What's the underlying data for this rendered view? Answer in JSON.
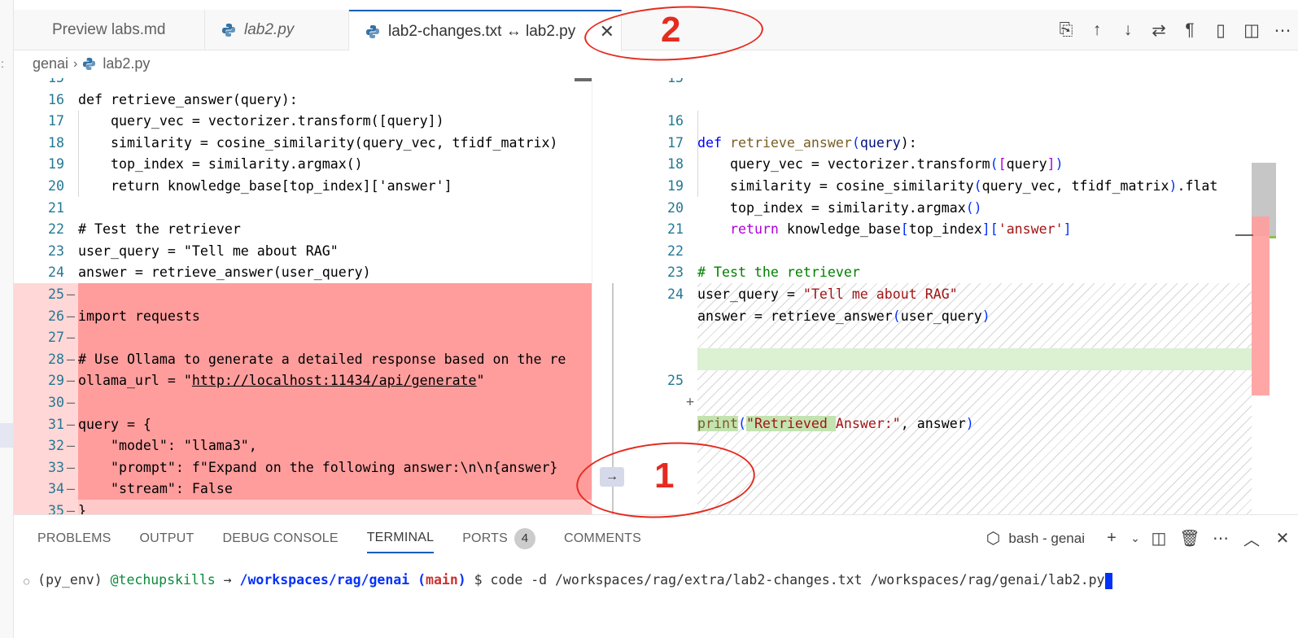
{
  "tabs": [
    {
      "label": "Preview labs.md",
      "active": false
    },
    {
      "label": "lab2.py",
      "active": false
    },
    {
      "label": "lab2-changes.txt ↔ lab2.py",
      "active": true
    }
  ],
  "toolbar_icons": [
    "open-file-icon",
    "arrow-up-icon",
    "arrow-down-icon",
    "swap-icon",
    "pilcrow-icon",
    "map-icon",
    "split-editor-icon",
    "more-icon"
  ],
  "breadcrumb": {
    "folder": "genai",
    "file": "lab2.py"
  },
  "left_editor": {
    "lines": [
      {
        "num": "15",
        "marker": "",
        "text": ""
      },
      {
        "num": "16",
        "marker": "",
        "text": "def retrieve_answer(query):"
      },
      {
        "num": "17",
        "marker": "",
        "text": "    query_vec = vectorizer.transform([query])"
      },
      {
        "num": "18",
        "marker": "",
        "text": "    similarity = cosine_similarity(query_vec, tfidf_matrix)"
      },
      {
        "num": "19",
        "marker": "",
        "text": "    top_index = similarity.argmax()"
      },
      {
        "num": "20",
        "marker": "",
        "text": "    return knowledge_base[top_index]['answer']"
      },
      {
        "num": "21",
        "marker": "",
        "text": ""
      },
      {
        "num": "22",
        "marker": "",
        "text": "# Test the retriever"
      },
      {
        "num": "23",
        "marker": "",
        "text": "user_query = \"Tell me about RAG\""
      },
      {
        "num": "24",
        "marker": "",
        "text": "answer = retrieve_answer(user_query)"
      },
      {
        "num": "25",
        "marker": "—",
        "text": ""
      },
      {
        "num": "26",
        "marker": "—",
        "text": "import requests"
      },
      {
        "num": "27",
        "marker": "—",
        "text": ""
      },
      {
        "num": "28",
        "marker": "—",
        "text": "# Use Ollama to generate a detailed response based on the re"
      },
      {
        "num": "29",
        "marker": "—",
        "text": "ollama_url = \"http://localhost:11434/api/generate\""
      },
      {
        "num": "30",
        "marker": "—",
        "text": ""
      },
      {
        "num": "31",
        "marker": "—",
        "text": "query = {"
      },
      {
        "num": "32",
        "marker": "—",
        "text": "    \"model\": \"llama3\","
      },
      {
        "num": "33",
        "marker": "—",
        "text": "    \"prompt\": f\"Expand on the following answer:\\n\\n{answer}"
      },
      {
        "num": "34",
        "marker": "—",
        "text": "    \"stream\": False"
      },
      {
        "num": "35",
        "marker": "—",
        "text": "}"
      }
    ]
  },
  "right_editor": {
    "line_numbers": [
      "15",
      "16",
      "17",
      "18",
      "19",
      "20",
      "21",
      "22",
      "23",
      "24",
      "25"
    ],
    "added_marker": "+",
    "code": {
      "l16": {
        "kw": "def",
        "fn": "retrieve_answer",
        "p1": "(",
        "arg": "query",
        "p2": "):"
      },
      "l17": {
        "a": "    query_vec = vectorizer.transform",
        "b1": "(",
        "b2": "[",
        "c": "query",
        "b3": "]",
        "b4": ")"
      },
      "l18": {
        "a": "    similarity = cosine_similarity",
        "b1": "(",
        "c": "query_vec, tfidf_matrix",
        "b2": ")",
        "d": ".flat"
      },
      "l19": {
        "a": "    top_index = similarity.argmax",
        "b": "()"
      },
      "l20": {
        "ctl": "return",
        "a": " knowledge_base",
        "b1": "[",
        "c": "top_index",
        "b2": "]",
        "b3": "[",
        "s": "'answer'",
        "b4": "]"
      },
      "l22": "# Test the retriever",
      "l23": {
        "a": "user_query = ",
        "s": "\"Tell me about RAG\""
      },
      "l24": {
        "a": "answer = retrieve_answer",
        "b1": "(",
        "c": "user_query",
        "b2": ")"
      },
      "l25": {
        "fn": "print",
        "b1": "(",
        "s1": "\"Retrieved ",
        "s2": "Answer:\"",
        "c": ", answer",
        "b2": ")"
      }
    }
  },
  "gutter_arrow": "→",
  "panel": {
    "tabs": [
      "PROBLEMS",
      "OUTPUT",
      "DEBUG CONSOLE",
      "TERMINAL",
      "PORTS",
      "COMMENTS"
    ],
    "active_tab": "TERMINAL",
    "ports_count": "4",
    "shell_label": "bash - genai",
    "terminal": {
      "bullet": "○",
      "env": "(py_env) ",
      "user": "@techupskills",
      "arrow": " → ",
      "path": "/workspaces/rag/genai",
      "branch_open": " (",
      "branch": "main",
      "branch_close": ")",
      "command": " $ code -d /workspaces/rag/extra/lab2-changes.txt /workspaces/rag/genai/lab2.py"
    }
  },
  "annotations": {
    "first": "1",
    "second": "2",
    "color": "#e52b20"
  },
  "colors": {
    "deleted": "#ff9d9d",
    "added": "#dcf0d2",
    "accent": "#005fb8"
  }
}
